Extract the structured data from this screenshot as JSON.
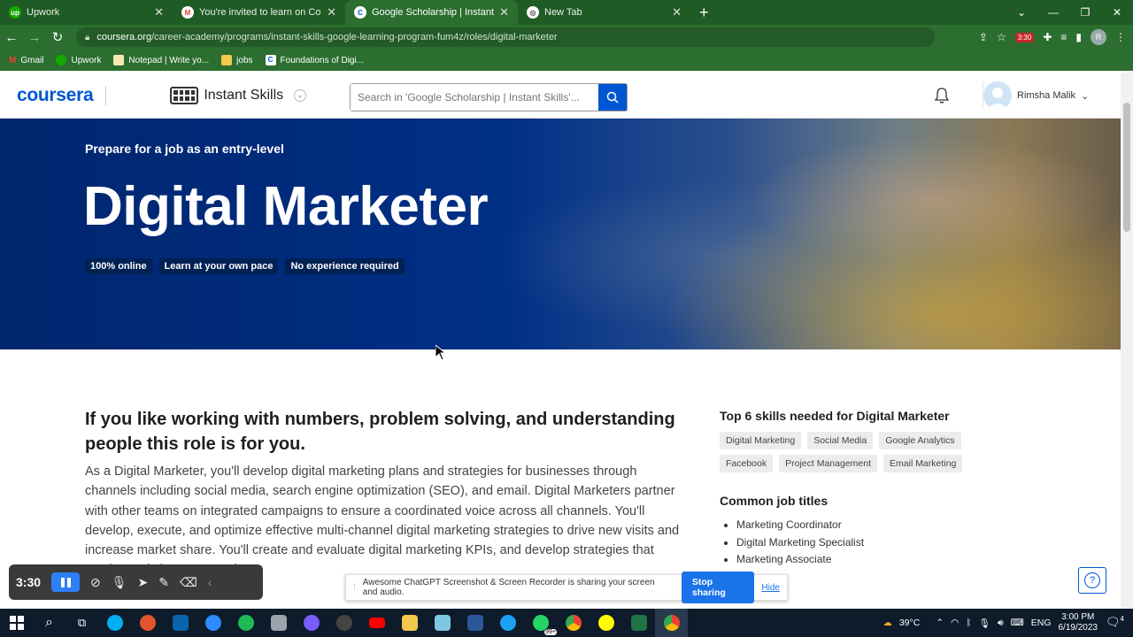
{
  "browser": {
    "tabs": [
      {
        "title": "Upwork",
        "fav": "up",
        "color": "#14a800"
      },
      {
        "title": "You're invited to learn on Course",
        "fav": "M",
        "color": "#ea4335"
      },
      {
        "title": "Google Scholarship | Instant Skill",
        "fav": "C",
        "color": "#0056d2"
      },
      {
        "title": "New Tab",
        "fav": "◎",
        "color": "#888888"
      }
    ],
    "url_domain": "coursera.org",
    "url_path": "/career-academy/programs/instant-skills-google-learning-program-fum4z/roles/digital-marketer",
    "extension_badge": "3:30",
    "profile_initial": "R",
    "bookmarks": [
      "Gmail",
      "Upwork",
      "Notepad | Write yo...",
      "jobs",
      "Foundations of Digi..."
    ]
  },
  "header": {
    "logo": "coursera",
    "program": "Instant Skills",
    "search_placeholder": "Search in 'Google Scholarship | Instant Skills'...",
    "user_name": "Rimsha Malik"
  },
  "hero": {
    "subtitle": "Prepare for a job as an entry-level",
    "title": "Digital Marketer",
    "chips": [
      "100% online",
      "Learn at your own pace",
      "No experience required"
    ]
  },
  "content": {
    "heading": "If you like working with numbers, problem solving, and understanding people this role is for you.",
    "body": "As a Digital Marketer, you'll develop digital marketing plans and strategies for businesses through channels including social media, search engine optimization (SEO), and email. Digital Marketers partner with other teams on integrated campaigns to ensure a coordinated voice across all channels. You'll develop, execute, and optimize effective multi-channel digital marketing strategies to drive new visits and increase market share. You'll create and evaluate digital marketing KPIs, and develop strategies that continuously improve results."
  },
  "sidebar": {
    "skills_title": "Top 6 skills needed for Digital Marketer",
    "skills": [
      "Digital Marketing",
      "Social Media",
      "Google Analytics",
      "Facebook",
      "Project Management",
      "Email Marketing"
    ],
    "jobs_title": "Common job titles",
    "jobs": [
      "Marketing Coordinator",
      "Digital Marketing Specialist",
      "Marketing Associate"
    ]
  },
  "recorder": {
    "time": "3:30"
  },
  "share_bar": {
    "message": "Awesome ChatGPT Screenshot & Screen Recorder is sharing your screen and audio.",
    "stop_label": "Stop sharing",
    "hide_label": "Hide"
  },
  "taskbar": {
    "weather": "39°C",
    "lang": "ENG",
    "time": "3:00 PM",
    "date": "6/19/2023",
    "notif_count": "4",
    "badge_whatsapp": "99+"
  }
}
